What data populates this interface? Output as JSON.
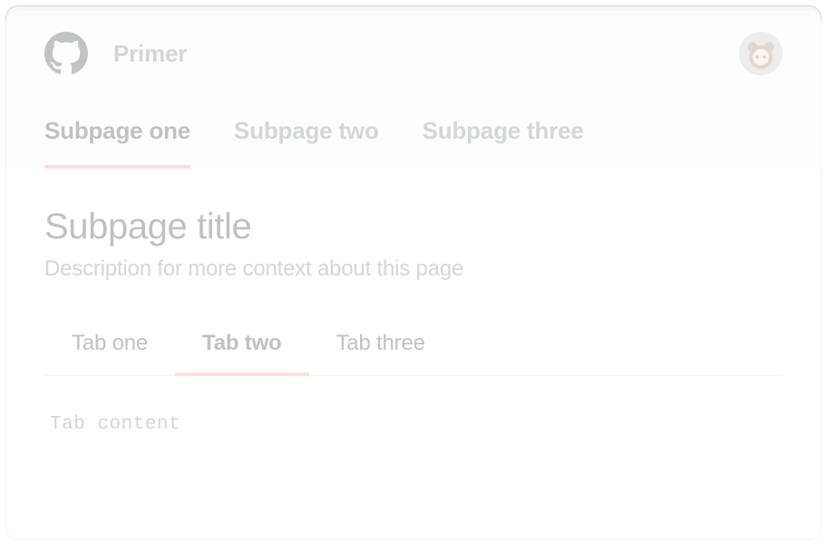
{
  "brand": {
    "label": "Primer"
  },
  "subpages": [
    {
      "label": "Subpage one",
      "active": true
    },
    {
      "label": "Subpage two",
      "active": false
    },
    {
      "label": "Subpage three",
      "active": false
    }
  ],
  "page": {
    "title": "Subpage title",
    "description": "Description for more context about this page"
  },
  "tabs": [
    {
      "label": "Tab one",
      "active": false
    },
    {
      "label": "Tab two",
      "active": true
    },
    {
      "label": "Tab three",
      "active": false
    }
  ],
  "tab_content": "Tab content"
}
